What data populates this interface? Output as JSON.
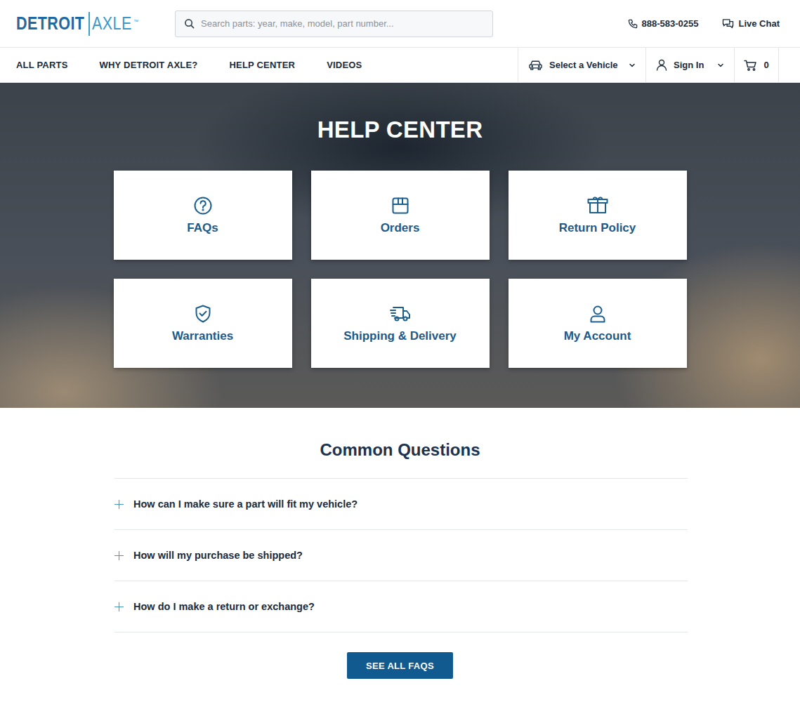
{
  "logo": {
    "first": "DETROIT",
    "second": "AXLE",
    "mark": "™"
  },
  "search": {
    "placeholder": "Search parts: year, make, model, part number..."
  },
  "header_links": {
    "phone": "888-583-0255",
    "chat": "Live Chat"
  },
  "nav": {
    "items": [
      {
        "label": "ALL PARTS"
      },
      {
        "label": "WHY DETROIT AXLE?"
      },
      {
        "label": "HELP CENTER"
      },
      {
        "label": "VIDEOS"
      }
    ],
    "vehicle": "Select a Vehicle",
    "sign_in": "Sign In",
    "cart_count": "0"
  },
  "hero": {
    "title": "HELP CENTER",
    "cards": [
      {
        "label": "FAQs"
      },
      {
        "label": "Orders"
      },
      {
        "label": "Return Policy"
      },
      {
        "label": "Warranties"
      },
      {
        "label": "Shipping & Delivery"
      },
      {
        "label": "My Account"
      }
    ]
  },
  "faq": {
    "title": "Common Questions",
    "items": [
      {
        "question": "How can I make sure a part will fit my vehicle?",
        "expanded": false
      },
      {
        "question": "How will my purchase be shipped?",
        "expanded": false
      },
      {
        "question": "How do I make a return or exchange?",
        "expanded": false
      }
    ],
    "button": "SEE ALL FAQS"
  }
}
